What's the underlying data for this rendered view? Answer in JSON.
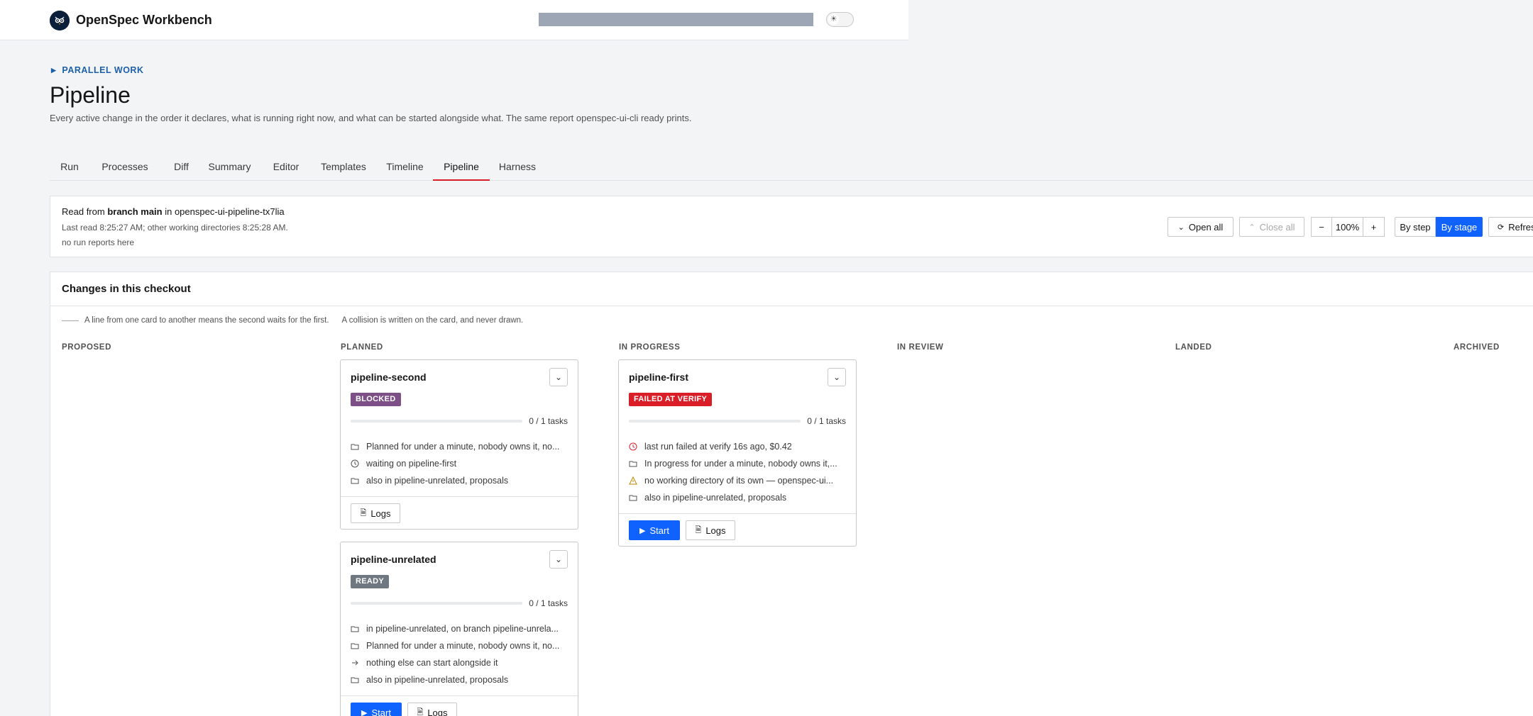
{
  "app": {
    "title": "OpenSpec Workbench"
  },
  "header": {
    "eyebrow": "PARALLEL WORK",
    "title": "Pipeline",
    "description": "Every active change in the order it declares, what is running right now, and what can be started alongside what. The same report openspec-ui-cli ready prints."
  },
  "tabs": [
    {
      "label": "Run"
    },
    {
      "label": "Processes"
    },
    {
      "label": "Diff"
    },
    {
      "label": "Summary"
    },
    {
      "label": "Editor"
    },
    {
      "label": "Templates"
    },
    {
      "label": "Timeline"
    },
    {
      "label": "Pipeline",
      "active": true
    },
    {
      "label": "Harness"
    }
  ],
  "info": {
    "read_prefix": "Read from ",
    "branch": "branch main",
    "read_mid": " in ",
    "repo": "openspec-ui-pipeline-tx7lia",
    "last_read": "Last read 8:25:27 AM; other working directories 8:25:28 AM.",
    "reports": "no run reports here"
  },
  "toolbar": {
    "open_all": "Open all",
    "close_all": "Close all",
    "zoom_out": "−",
    "zoom": "100%",
    "zoom_in": "+",
    "by_step": "By step",
    "by_stage": "By stage",
    "refresh": "Refresh"
  },
  "changes": {
    "title": "Changes in this checkout",
    "legend_line": "A line from one card to another means the second waits for the first.",
    "legend_collision": "A collision is written on the card, and never drawn.",
    "columns": [
      "PROPOSED",
      "PLANNED",
      "IN PROGRESS",
      "IN REVIEW",
      "LANDED",
      "ARCHIVED"
    ]
  },
  "cards": {
    "second": {
      "title": "pipeline-second",
      "badge": "BLOCKED",
      "progress": 0,
      "tasks": "0 / 1 tasks",
      "rows": [
        {
          "icon": "folder-icon",
          "text": "Planned for under a minute, nobody owns it, no..."
        },
        {
          "icon": "clock-icon",
          "text": "waiting on pipeline-first"
        },
        {
          "icon": "folder-icon",
          "text": "also in pipeline-unrelated, proposals"
        }
      ],
      "logs": "Logs"
    },
    "unrelated": {
      "title": "pipeline-unrelated",
      "badge": "READY",
      "progress": 0,
      "tasks": "0 / 1 tasks",
      "rows": [
        {
          "icon": "folder-icon",
          "text": "in pipeline-unrelated, on branch pipeline-unrela..."
        },
        {
          "icon": "folder-icon",
          "text": "Planned for under a minute, nobody owns it, no..."
        },
        {
          "icon": "arrow-right-icon",
          "text": "nothing else can start alongside it"
        },
        {
          "icon": "folder-icon",
          "text": "also in pipeline-unrelated, proposals"
        }
      ],
      "start": "Start",
      "logs": "Logs"
    },
    "first": {
      "title": "pipeline-first",
      "badge": "FAILED AT VERIFY",
      "progress": 0,
      "tasks": "0 / 1 tasks",
      "rows": [
        {
          "icon": "clock-icon",
          "text": "last run failed at verify 16s ago, $0.42"
        },
        {
          "icon": "folder-icon",
          "text": "In progress for under a minute, nobody owns it,..."
        },
        {
          "icon": "warning-icon",
          "text": "no working directory of its own — openspec-ui..."
        },
        {
          "icon": "folder-icon",
          "text": "also in pipeline-unrelated, proposals"
        }
      ],
      "start": "Start",
      "logs": "Logs"
    }
  },
  "colors": {
    "primary": "#0f62fe",
    "active_tab": "#da1e28",
    "blocked": "#7c4f86",
    "failed": "#da1e28",
    "ready": "#6f7780",
    "eyebrow": "#1d5fa8"
  }
}
